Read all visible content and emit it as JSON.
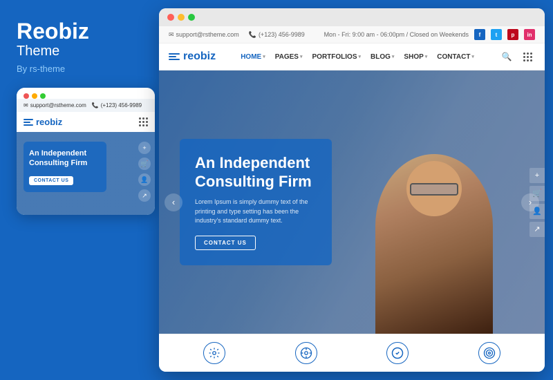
{
  "left": {
    "title": "Reobiz",
    "subtitle": "Theme",
    "by": "By rs-theme"
  },
  "mobile": {
    "dots": [
      "red",
      "yellow",
      "green"
    ],
    "email": "support@rstheme.com",
    "phone": "(+123) 456-9989",
    "logo": "reobiz",
    "hero_title": "An Independent Consulting Firm",
    "hero_btn": "CONTACT US"
  },
  "browser": {
    "dots": [
      "red",
      "yellow",
      "green"
    ],
    "topbar": {
      "email": "support@rstheme.com",
      "phone": "(+123) 456-9989",
      "hours": "Mon - Fri: 9:00 am - 06:00pm / Closed on Weekends"
    },
    "nav": {
      "logo": "reobiz",
      "links": [
        "HOME",
        "PAGES",
        "PORTFOLIOS",
        "BLOG",
        "SHOP",
        "CONTACT"
      ]
    },
    "hero": {
      "title": "An Independent Consulting Firm",
      "desc": "Lorem Ipsum is simply dummy text of the printing and type setting has been the industry's standard dummy text.",
      "btn": "CONTACT US"
    },
    "bottom_icons": [
      {
        "icon": "⚙",
        "label": ""
      },
      {
        "icon": "🔧",
        "label": ""
      },
      {
        "icon": "✓",
        "label": ""
      },
      {
        "icon": "◎",
        "label": ""
      }
    ]
  },
  "colors": {
    "brand_blue": "#1565C0",
    "white": "#ffffff",
    "topbar_bg": "#f8f8f8"
  }
}
